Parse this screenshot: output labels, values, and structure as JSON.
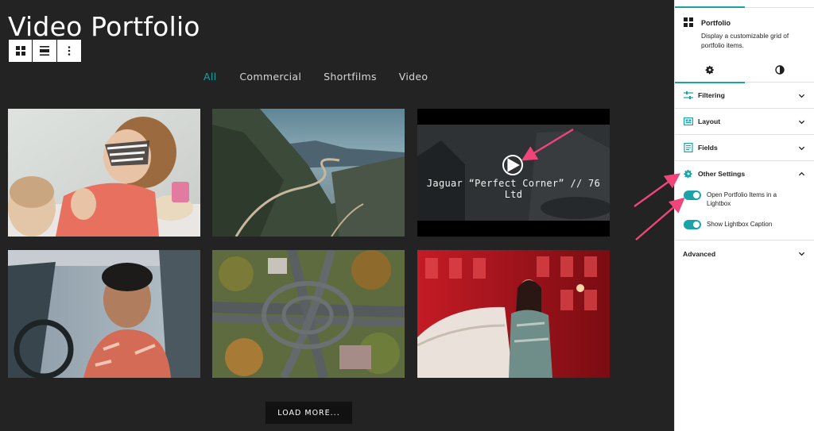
{
  "canvas": {
    "page_title": "Video Portfolio",
    "filters": [
      "All",
      "Commercial",
      "Shortfilms",
      "Video"
    ],
    "active_filter": "All",
    "items": [
      {
        "description": "child with tiger face paint"
      },
      {
        "description": "mountain road aerial"
      },
      {
        "description": "video thumbnail",
        "title": "Jaguar “Perfect Corner” // 76 Ltd"
      },
      {
        "description": "man in car"
      },
      {
        "description": "highway interchange aerial"
      },
      {
        "description": "woman by car in red light"
      }
    ],
    "load_more": "LOAD MORE...",
    "toolbar_icons": [
      "grid-icon",
      "align-icon",
      "more-options-icon"
    ]
  },
  "sidebar": {
    "block_name": "Portfolio",
    "block_description": "Display a customizable grid of portfolio items.",
    "tabs": [
      {
        "icon": "gear-icon",
        "active": true
      },
      {
        "icon": "contrast-icon",
        "active": false
      }
    ],
    "panels": {
      "filtering": "Filtering",
      "layout": "Layout",
      "fields": "Fields",
      "other_settings": "Other Settings",
      "advanced": "Advanced"
    },
    "toggles": {
      "lightbox": {
        "label": "Open Portfolio Items in a Lightbox",
        "on": true
      },
      "caption": {
        "label": "Show Lightbox Caption",
        "on": true
      }
    }
  },
  "colors": {
    "accent": "#1aa3a8",
    "canvas_bg": "#232323",
    "arrow": "#f0457a"
  }
}
